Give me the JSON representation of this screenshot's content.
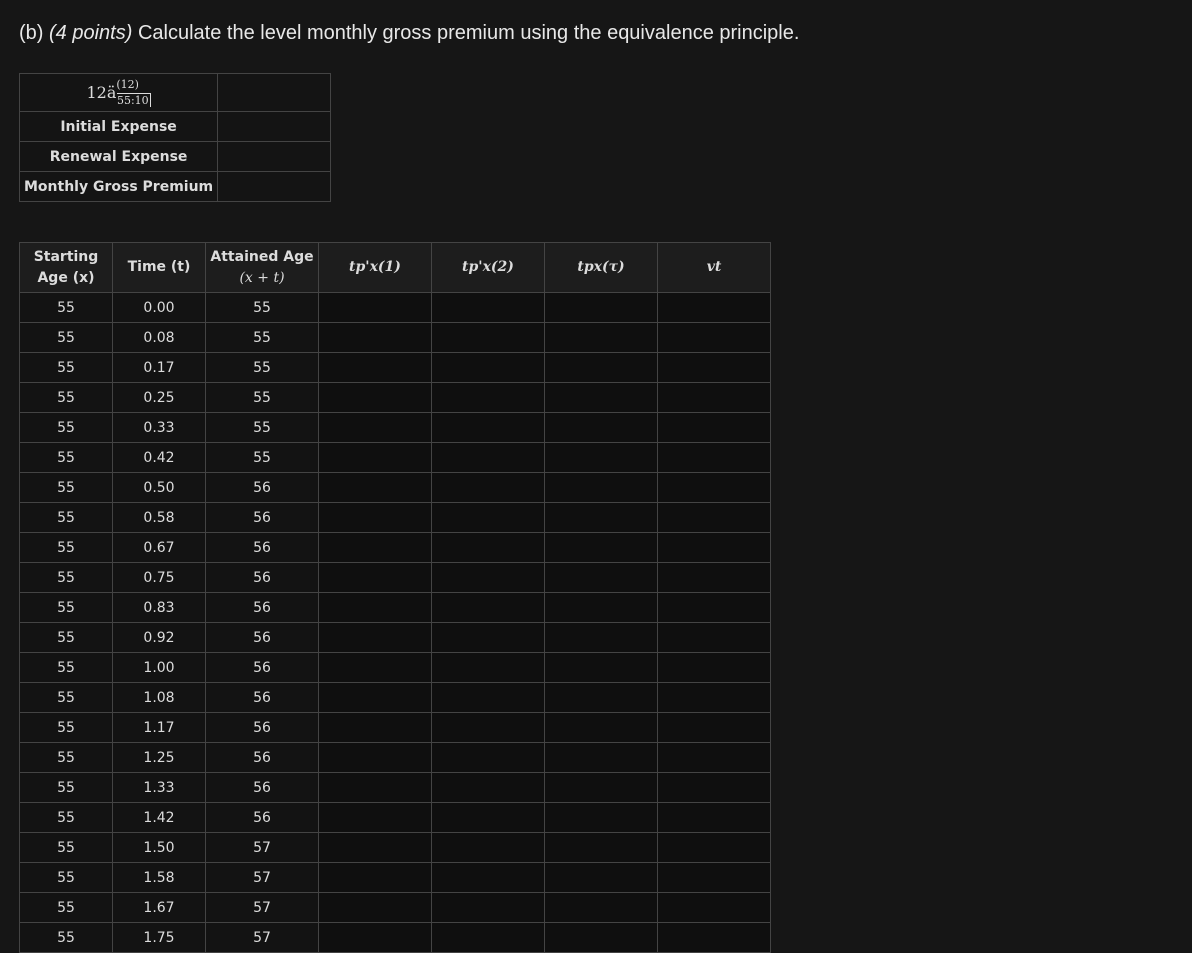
{
  "question": {
    "label": "(b)",
    "points": "(4 points)",
    "text": "Calculate the level monthly gross premium using the equivalence principle."
  },
  "summary": {
    "rows": [
      {
        "label": "12ä(12) 55:10",
        "value": ""
      },
      {
        "label": "Initial Expense",
        "value": ""
      },
      {
        "label": "Renewal Expense",
        "value": ""
      },
      {
        "label": "Monthly Gross Premium",
        "value": ""
      }
    ],
    "formula": {
      "prefix": "12ä",
      "superscript": "(12)",
      "subscript": "55:10"
    }
  },
  "table": {
    "headers": {
      "starting_age_line1": "Starting",
      "starting_age_line2": "Age (x)",
      "time": "Time (t)",
      "attained_line1": "Attained Age",
      "attained_line2": "(x + t)",
      "p1": "tp'x(1)",
      "p2": "tp'x(2)",
      "ptau": "tpx(τ)",
      "vt": "vt"
    },
    "rows": [
      {
        "age": "55",
        "time": "0.00",
        "attained": "55"
      },
      {
        "age": "55",
        "time": "0.08",
        "attained": "55"
      },
      {
        "age": "55",
        "time": "0.17",
        "attained": "55"
      },
      {
        "age": "55",
        "time": "0.25",
        "attained": "55"
      },
      {
        "age": "55",
        "time": "0.33",
        "attained": "55"
      },
      {
        "age": "55",
        "time": "0.42",
        "attained": "55"
      },
      {
        "age": "55",
        "time": "0.50",
        "attained": "56"
      },
      {
        "age": "55",
        "time": "0.58",
        "attained": "56"
      },
      {
        "age": "55",
        "time": "0.67",
        "attained": "56"
      },
      {
        "age": "55",
        "time": "0.75",
        "attained": "56"
      },
      {
        "age": "55",
        "time": "0.83",
        "attained": "56"
      },
      {
        "age": "55",
        "time": "0.92",
        "attained": "56"
      },
      {
        "age": "55",
        "time": "1.00",
        "attained": "56"
      },
      {
        "age": "55",
        "time": "1.08",
        "attained": "56"
      },
      {
        "age": "55",
        "time": "1.17",
        "attained": "56"
      },
      {
        "age": "55",
        "time": "1.25",
        "attained": "56"
      },
      {
        "age": "55",
        "time": "1.33",
        "attained": "56"
      },
      {
        "age": "55",
        "time": "1.42",
        "attained": "56"
      },
      {
        "age": "55",
        "time": "1.50",
        "attained": "57"
      },
      {
        "age": "55",
        "time": "1.58",
        "attained": "57"
      },
      {
        "age": "55",
        "time": "1.67",
        "attained": "57"
      },
      {
        "age": "55",
        "time": "1.75",
        "attained": "57"
      }
    ]
  }
}
